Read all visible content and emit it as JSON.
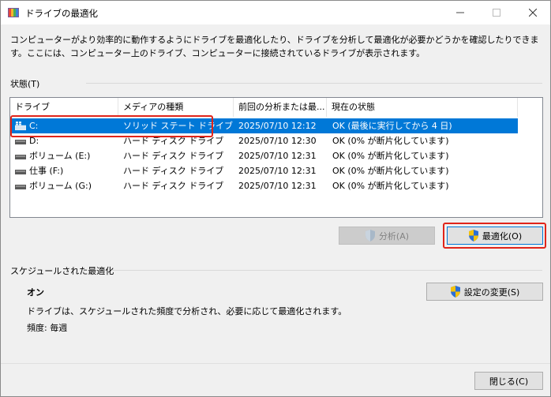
{
  "window": {
    "title": "ドライブの最適化",
    "icon": "defrag-app-icon"
  },
  "description": "コンピューターがより効率的に動作するようにドライブを最適化したり、ドライブを分析して最適化が必要かどうかを確認したりできます。ここには、コンピューター上のドライブ、コンピューターに接続されているドライブが表示されます。",
  "status_group": {
    "label": "状態(T)"
  },
  "drives_table": {
    "columns": [
      "ドライブ",
      "メディアの種類",
      "前回の分析または最...",
      "現在の状態"
    ],
    "rows": [
      {
        "drive": "C:",
        "media": "ソリッド ステート ドライブ",
        "last": "2025/07/10 12:12",
        "status": "OK (最後に実行してから 4 日)",
        "selected": true,
        "icon": "windows-drive-icon"
      },
      {
        "drive": "D:",
        "media": "ハード ディスク ドライブ",
        "last": "2025/07/10 12:30",
        "status": "OK (0% が断片化しています)",
        "selected": false,
        "icon": "hard-drive-icon"
      },
      {
        "drive": "ボリューム (E:)",
        "media": "ハード ディスク ドライブ",
        "last": "2025/07/10 12:31",
        "status": "OK (0% が断片化しています)",
        "selected": false,
        "icon": "hard-drive-icon"
      },
      {
        "drive": "仕事 (F:)",
        "media": "ハード ディスク ドライブ",
        "last": "2025/07/10 12:31",
        "status": "OK (0% が断片化しています)",
        "selected": false,
        "icon": "hard-drive-icon"
      },
      {
        "drive": "ボリューム (G:)",
        "media": "ハード ディスク ドライブ",
        "last": "2025/07/10 12:31",
        "status": "OK (0% が断片化しています)",
        "selected": false,
        "icon": "hard-drive-icon"
      }
    ]
  },
  "buttons": {
    "analyze": "分析(A)",
    "optimize": "最適化(O)",
    "change_settings": "設定の変更(S)",
    "close": "閉じる(C)"
  },
  "scheduled": {
    "label": "スケジュールされた最適化",
    "status": "オン",
    "description": "ドライブは、スケジュールされた頻度で分析され、必要に応じて最適化されます。",
    "frequency": "頻度: 毎週"
  },
  "colors": {
    "selection": "#0078d7",
    "highlight": "#e0241a"
  }
}
